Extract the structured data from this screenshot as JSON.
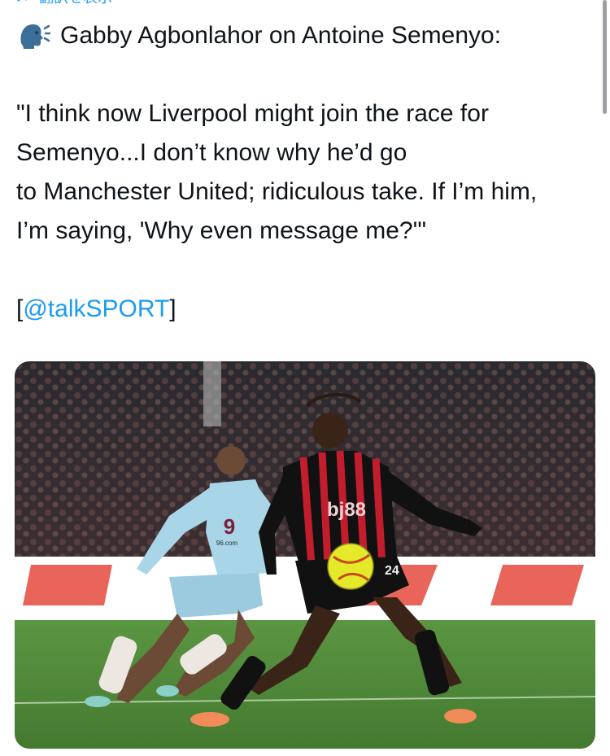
{
  "topbar": {
    "translate_label": "翻訳を表示",
    "translate_icon": "translate-icon"
  },
  "tweet": {
    "speaker_icon": "speaking-head-icon",
    "heading": "Gabby Agbonlahor on Antoine Semenyo:",
    "quote_lines": [
      "\"I think now Liverpool might join the race for",
      "Semenyo...I don’t know why he’d go",
      "to Manchester United; ridiculous take. If I’m him,",
      "I’m saying, 'Why even message me?'\""
    ],
    "source_open": "[",
    "source_mention": "@talkSPORT",
    "source_close": "]"
  },
  "media": {
    "left_player_number": "9",
    "left_player_sponsor": "96.com",
    "right_player_sponsor": "bj88",
    "right_player_number": "24",
    "colors": {
      "pitch": "#4f8a38",
      "burnley_kit": "#a9d5e8",
      "bournemouth_red": "#c21d2c",
      "bournemouth_black": "#111111",
      "ball": "#e4ea2a"
    }
  }
}
